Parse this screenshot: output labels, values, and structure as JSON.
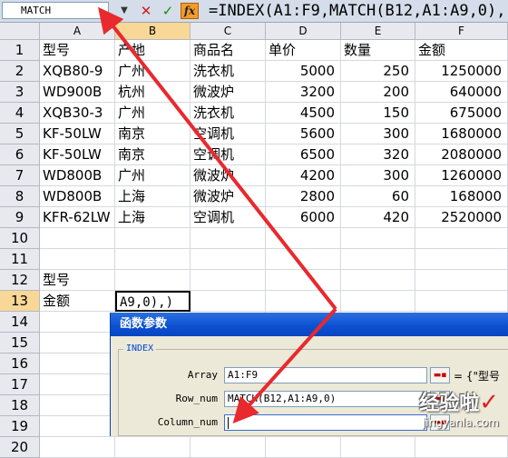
{
  "formula_bar": {
    "name_box": "MATCH",
    "dropdown_icon": "▼",
    "cancel_icon": "✕",
    "confirm_icon": "✓",
    "fx_icon": "fx",
    "formula": "=INDEX(A1:F9,MATCH(B12,A1:A9,0),"
  },
  "columns": [
    "A",
    "B",
    "C",
    "D",
    "E",
    "F"
  ],
  "rows": [
    "1",
    "2",
    "3",
    "4",
    "5",
    "6",
    "7",
    "8",
    "9",
    "10",
    "11",
    "12",
    "13",
    "14",
    "15",
    "16",
    "17",
    "18",
    "19",
    "20"
  ],
  "table": [
    [
      "型号",
      "产地",
      "商品名",
      "单价",
      "数量",
      "金额"
    ],
    [
      "XQB80-9",
      "广州",
      "洗衣机",
      "5000",
      "250",
      "1250000"
    ],
    [
      "WD900B",
      "杭州",
      "微波炉",
      "3200",
      "200",
      "640000"
    ],
    [
      "XQB30-3",
      "广州",
      "洗衣机",
      "4500",
      "150",
      "675000"
    ],
    [
      "KF-50LW",
      "南京",
      "空调机",
      "5600",
      "300",
      "1680000"
    ],
    [
      "KF-50LW",
      "南京",
      "空调机",
      "6500",
      "320",
      "2080000"
    ],
    [
      "WD800B",
      "广州",
      "微波炉",
      "4200",
      "300",
      "1260000"
    ],
    [
      "WD800B",
      "上海",
      "微波炉",
      "2800",
      "60",
      "168000"
    ],
    [
      "KFR-62LW",
      "上海",
      "空调机",
      "6000",
      "420",
      "2520000"
    ]
  ],
  "labels": {
    "a12": "型号",
    "a13": "金额"
  },
  "active_cell": {
    "value": "A9,0),)"
  },
  "dialog": {
    "title": "函数参数",
    "function_name": "INDEX",
    "args": [
      {
        "label": "Array",
        "value": "A1:F9",
        "preview": "= {\"型号"
      },
      {
        "label": "Row_num",
        "value": "MATCH(B12,A1:A9,0)",
        "preview": ""
      },
      {
        "label": "Column_num",
        "value": "",
        "preview": ""
      }
    ]
  },
  "watermark": {
    "main": "经验啦",
    "check": "✓",
    "url": "jingyanla.com"
  },
  "colors": {
    "arrow": "#e8292e",
    "selected_header": "#f9d796",
    "dialog_title": "#0b4fd0"
  }
}
